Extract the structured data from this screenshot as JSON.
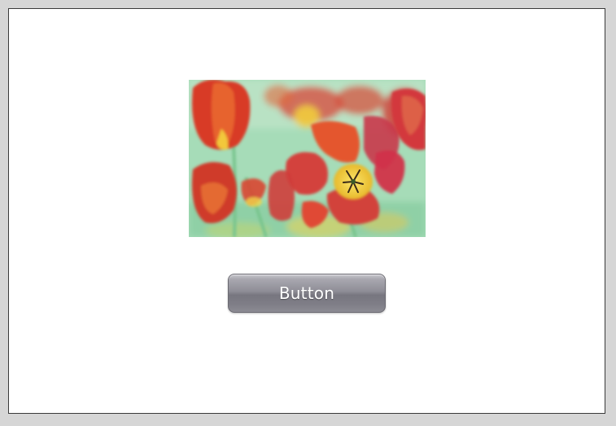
{
  "window": {
    "background": "#ffffff",
    "border_color": "#3a3a3a"
  },
  "image": {
    "subject": "tulips-photo",
    "colors": {
      "petal_red": "#d63a2a",
      "petal_orange": "#e4622e",
      "center_yellow": "#f2d43a",
      "stem_green": "#7fc99a",
      "background_mint": "#9ed8b4"
    }
  },
  "button": {
    "label": "Button",
    "gradient_top": "#c9c8ce",
    "gradient_bottom": "#7f7e87"
  }
}
